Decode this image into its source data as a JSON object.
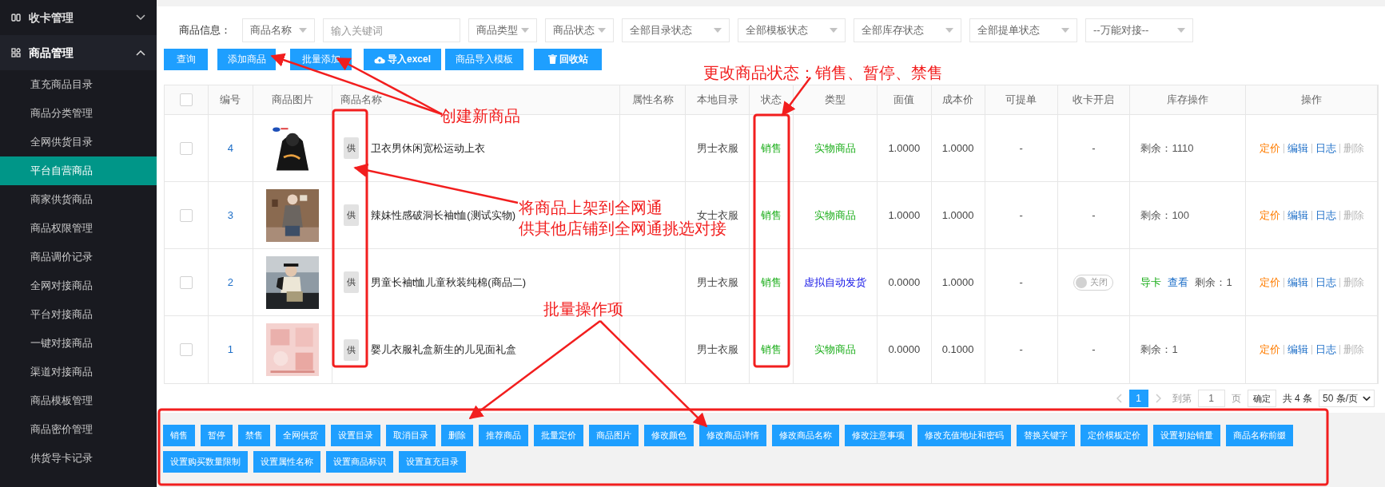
{
  "sidebar": {
    "items": [
      {
        "label": "收卡管理",
        "expanded": false
      },
      {
        "label": "商品管理",
        "expanded": true,
        "children": [
          {
            "label": "直充商品目录",
            "selected": false
          },
          {
            "label": "商品分类管理",
            "selected": false
          },
          {
            "label": "全网供货目录",
            "selected": false
          },
          {
            "label": "平台自营商品",
            "selected": true
          },
          {
            "label": "商家供货商品",
            "selected": false
          },
          {
            "label": "商品权限管理",
            "selected": false
          },
          {
            "label": "商品调价记录",
            "selected": false
          },
          {
            "label": "全网对接商品",
            "selected": false
          },
          {
            "label": "平台对接商品",
            "selected": false
          },
          {
            "label": "一键对接商品",
            "selected": false
          },
          {
            "label": "渠道对接商品",
            "selected": false
          },
          {
            "label": "商品模板管理",
            "selected": false
          },
          {
            "label": "商品密价管理",
            "selected": false
          },
          {
            "label": "供货导卡记录",
            "selected": false
          }
        ]
      }
    ]
  },
  "filters": {
    "label": "商品信息：",
    "fields": [
      {
        "kind": "select",
        "value": "商品名称"
      },
      {
        "kind": "input",
        "placeholder": "输入关键词"
      },
      {
        "kind": "select",
        "value": "商品类型"
      },
      {
        "kind": "select",
        "value": "商品状态"
      },
      {
        "kind": "select",
        "value": "全部目录状态"
      },
      {
        "kind": "select",
        "value": "全部模板状态"
      },
      {
        "kind": "select",
        "value": "全部库存状态"
      },
      {
        "kind": "select",
        "value": "全部提单状态"
      },
      {
        "kind": "select",
        "value": "--万能对接--"
      }
    ]
  },
  "toolbar": [
    {
      "label": "查询",
      "kind": "plain"
    },
    {
      "label": "添加商品",
      "kind": "plain"
    },
    {
      "label": "批量添加",
      "kind": "plain"
    },
    {
      "label": "导入excel",
      "kind": "upload"
    },
    {
      "label": "商品导入模板",
      "kind": "plain"
    },
    {
      "label": "回收站",
      "kind": "trash"
    }
  ],
  "table": {
    "select_all": {
      "checked": false
    },
    "columns": [
      "编号",
      "商品图片",
      "商品名称",
      "属性名称",
      "本地目录",
      "状态",
      "类型",
      "面值",
      "成本价",
      "可提单",
      "收卡开启",
      "库存操作",
      "操作"
    ],
    "rows": [
      {
        "checked": false,
        "id": "4",
        "picture": {
          "kind": "picture"
        },
        "tag": "供",
        "name": "卫衣男休闲宽松运动上衣",
        "catalog": "男士衣服",
        "status": "销售",
        "type": {
          "text": "实物商品",
          "color": "#1aad19"
        },
        "face_value": "1.0000",
        "cost": "1.0000",
        "withdrawable": "-",
        "card_switch": {
          "kind": "text",
          "text": "-"
        },
        "stock": [
          {
            "text": "剩余：1110",
            "kind": "plain"
          }
        ],
        "actions": [
          {
            "label": "定价",
            "kind": "orange"
          },
          {
            "label": "编辑",
            "kind": "link"
          },
          {
            "label": "日志",
            "kind": "link"
          },
          {
            "label": "删除",
            "kind": "muted"
          }
        ]
      },
      {
        "checked": false,
        "id": "3",
        "picture": {
          "kind": "picture"
        },
        "tag": "供",
        "name": "辣妹性感破洞长袖t恤(测试实物)",
        "catalog": "女士衣服",
        "status": "销售",
        "type": {
          "text": "实物商品",
          "color": "#1aad19"
        },
        "face_value": "1.0000",
        "cost": "1.0000",
        "withdrawable": "-",
        "card_switch": {
          "kind": "text",
          "text": "-"
        },
        "stock": [
          {
            "text": "剩余：100",
            "kind": "plain"
          }
        ],
        "actions": [
          {
            "label": "定价",
            "kind": "orange"
          },
          {
            "label": "编辑",
            "kind": "link"
          },
          {
            "label": "日志",
            "kind": "link"
          },
          {
            "label": "删除",
            "kind": "muted"
          }
        ]
      },
      {
        "checked": false,
        "id": "2",
        "picture": {
          "kind": "picture"
        },
        "tag": "供",
        "name": "男童长袖t恤儿童秋装纯棉(商品二)",
        "catalog": "男士衣服",
        "status": "销售",
        "type": {
          "text": "虚拟自动发货",
          "color": "#1212e6"
        },
        "face_value": "0.0000",
        "cost": "1.0000",
        "withdrawable": "-",
        "card_switch": {
          "kind": "toggle",
          "on": false,
          "text": "关闭"
        },
        "stock": [
          {
            "text": "导卡",
            "kind": "green"
          },
          {
            "text": "查看",
            "kind": "link"
          },
          {
            "text": "剩余：1",
            "kind": "plain"
          }
        ],
        "actions": [
          {
            "label": "定价",
            "kind": "orange"
          },
          {
            "label": "编辑",
            "kind": "link"
          },
          {
            "label": "日志",
            "kind": "link"
          },
          {
            "label": "删除",
            "kind": "muted"
          }
        ]
      },
      {
        "checked": false,
        "id": "1",
        "picture": {
          "kind": "picture"
        },
        "tag": "供",
        "name": "婴儿衣服礼盒新生的儿见面礼盒",
        "catalog": "男士衣服",
        "status": "销售",
        "type": {
          "text": "实物商品",
          "color": "#1aad19"
        },
        "face_value": "0.0000",
        "cost": "0.1000",
        "withdrawable": "-",
        "card_switch": {
          "kind": "text",
          "text": "-"
        },
        "stock": [
          {
            "text": "剩余：1",
            "kind": "plain"
          }
        ],
        "actions": [
          {
            "label": "定价",
            "kind": "orange"
          },
          {
            "label": "编辑",
            "kind": "link"
          },
          {
            "label": "日志",
            "kind": "link"
          },
          {
            "label": "删除",
            "kind": "muted"
          }
        ]
      }
    ]
  },
  "pagination": {
    "current": "1",
    "goto": "到第",
    "page_input": "1",
    "page_unit": "页",
    "confirm": "确定",
    "total": "共 4 条",
    "page_size": "50 条/页"
  },
  "batch_buttons": [
    "销售",
    "暂停",
    "禁售",
    "全网供货",
    "设置目录",
    "取消目录",
    "删除",
    "推荐商品",
    "批量定价",
    "商品图片",
    "修改颜色",
    "修改商品详情",
    "修改商品名称",
    "修改注意事项",
    "修改充值地址和密码",
    "替换关键字",
    "定价模板定价",
    "设置初始销量",
    "商品名称前缀",
    "设置购买数量限制",
    "设置属性名称",
    "设置商品标识",
    "设置直充目录"
  ],
  "annotations": [
    {
      "lines": [
        "创建新商品"
      ]
    },
    {
      "lines": [
        "更改商品状态：销售、暂停、禁售"
      ]
    },
    {
      "lines": [
        "将商品上架到全网通",
        "供其他店铺到全网通挑选对接"
      ]
    },
    {
      "lines": [
        "批量操作项"
      ]
    }
  ]
}
